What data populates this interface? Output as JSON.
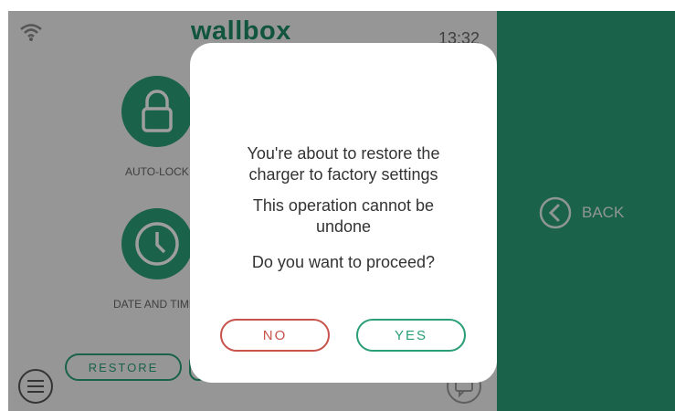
{
  "header": {
    "brand": "wallbox",
    "time": "13:32",
    "wifi_icon": "wifi-icon"
  },
  "tiles": [
    {
      "label": "AUTO-LOCK",
      "icon": "lock-icon"
    },
    {
      "label": "DATE AND TIME",
      "icon": "clock-icon"
    }
  ],
  "bottom": {
    "restore_label": "RESTORE",
    "menu_icon": "menu-icon",
    "chat_icon": "chat-icon"
  },
  "side": {
    "back_label": "BACK",
    "back_icon": "chevron-left-circle-icon"
  },
  "dialog": {
    "message_line1": "You're about to restore the charger to factory settings",
    "message_line2": "This operation cannot be undone",
    "message_line3": "Do you want to proceed?",
    "no_label": "NO",
    "yes_label": "YES"
  },
  "colors": {
    "accent": "#2a9e78",
    "danger": "#c8524c",
    "side_bg": "#2a9e78",
    "dialog_bg": "#ffffff"
  }
}
